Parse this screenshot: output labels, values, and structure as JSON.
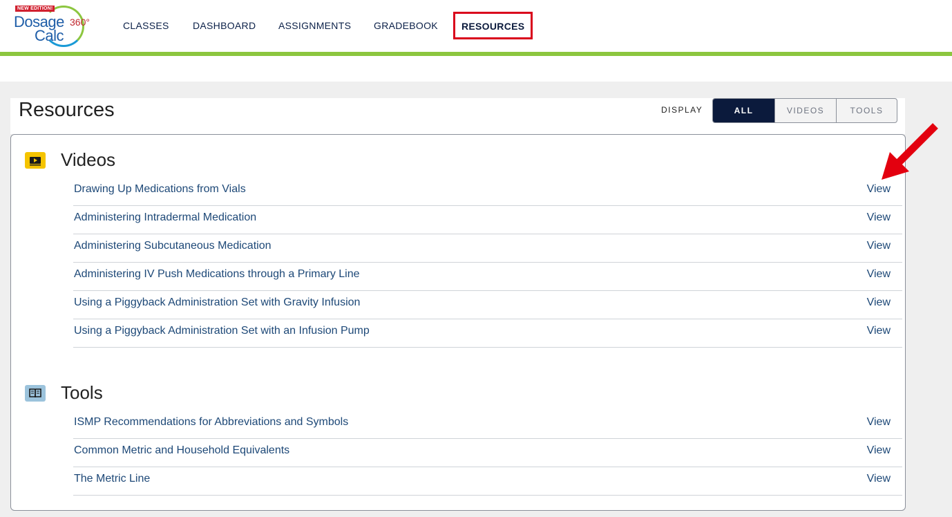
{
  "logo": {
    "badge": "NEW EDITION!",
    "word1": "Dosage",
    "word2": "Calc",
    "degree": "360°"
  },
  "nav": {
    "items": [
      {
        "label": "CLASSES"
      },
      {
        "label": "DASHBOARD"
      },
      {
        "label": "ASSIGNMENTS"
      },
      {
        "label": "GRADEBOOK"
      },
      {
        "label": "RESOURCES",
        "active": true
      }
    ]
  },
  "page": {
    "title": "Resources",
    "display_label": "DISPLAY",
    "filters": [
      {
        "label": "ALL",
        "active": true
      },
      {
        "label": "VIDEOS"
      },
      {
        "label": "TOOLS"
      }
    ]
  },
  "videos": {
    "heading": "Videos",
    "icon": "video-icon",
    "items": [
      {
        "title": "Drawing Up Medications from Vials",
        "action": "View"
      },
      {
        "title": "Administering Intradermal Medication",
        "action": "View"
      },
      {
        "title": "Administering Subcutaneous Medication",
        "action": "View"
      },
      {
        "title": "Administering IV Push Medications through a Primary Line",
        "action": "View"
      },
      {
        "title": "Using a Piggyback Administration Set with Gravity Infusion",
        "action": "View"
      },
      {
        "title": "Using a Piggyback Administration Set with an Infusion Pump",
        "action": "View"
      }
    ]
  },
  "tools": {
    "heading": "Tools",
    "icon": "book-icon",
    "items": [
      {
        "title": "ISMP Recommendations for Abbreviations and Symbols",
        "action": "View"
      },
      {
        "title": "Common Metric and Household Equivalents",
        "action": "View"
      },
      {
        "title": "The Metric Line",
        "action": "View"
      }
    ]
  },
  "colors": {
    "accent_green": "#8cc63f",
    "nav_active_border": "#d9001b",
    "primary_navy": "#0b1a3c",
    "link": "#1d4877",
    "annotation_arrow": "#e3000f"
  }
}
